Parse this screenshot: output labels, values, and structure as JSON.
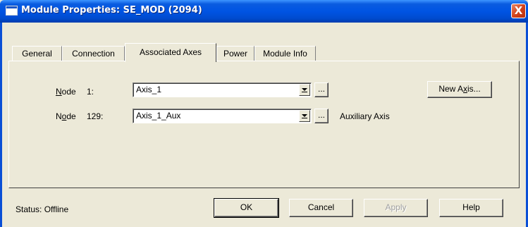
{
  "window": {
    "title": "Module Properties: SE_MOD (2094)",
    "close_glyph": "X",
    "close_icon": "close-icon",
    "app_icon": "window-icon"
  },
  "tabs": [
    {
      "label": "General"
    },
    {
      "label": "Connection"
    },
    {
      "label": "Associated Axes",
      "active": true
    },
    {
      "label": "Power"
    },
    {
      "label": "Module Info"
    }
  ],
  "axes": {
    "node1": {
      "label_prefix": "N",
      "label_rest": "ode",
      "number": "1:",
      "value": "Axis_1",
      "browse_label": "..."
    },
    "node129": {
      "label_prefix": "N",
      "label_u": "o",
      "label_rest": "de",
      "number": "129:",
      "value": "Axis_1_Aux",
      "browse_label": "...",
      "note": "Auxiliary Axis"
    },
    "new_axis": {
      "pre": "New A",
      "u": "x",
      "post": "is..."
    }
  },
  "footer": {
    "status": "Status:  Offline",
    "ok": "OK",
    "cancel": "Cancel",
    "apply": "Apply",
    "help": "Help"
  },
  "colors": {
    "titlebar": "#0054e3",
    "dialog_bg": "#ece9d8",
    "close_button": "#d2431c"
  }
}
